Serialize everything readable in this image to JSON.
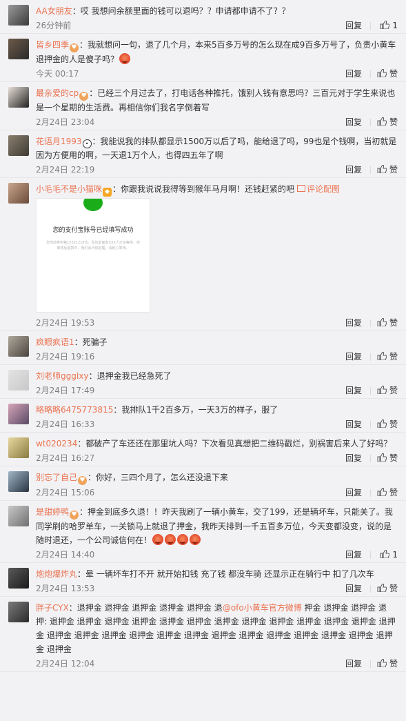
{
  "actions": {
    "reply_label": "回复",
    "like_label": "赞"
  },
  "comments": [
    {
      "user": "AA女朋友",
      "badge": "",
      "segments": [
        {
          "t": "text",
          "v": "：哎  我想问余额里面的钱可以退吗？？申请都申请不了？？"
        }
      ],
      "time": "26分钟前",
      "likes": "1",
      "avatar": {
        "c1": "#9a9a9a",
        "c2": "#3a3a3a"
      }
    },
    {
      "user": "皆乡四季",
      "badge": "heart",
      "segments": [
        {
          "t": "text",
          "v": "：我就想问一句，退了几个月，本来5百多万号的怎么现在成9百多万号了，负责小黄车退押金的人是傻子吗？"
        },
        {
          "t": "emoji",
          "v": "angry-face-emoji"
        }
      ],
      "time": "今天 00:17",
      "likes": "",
      "avatar": {
        "c1": "#6d5a4a",
        "c2": "#2b2b2b"
      }
    },
    {
      "user": "最亲爱的cp",
      "badge": "heart",
      "segments": [
        {
          "t": "text",
          "v": "：已经三个月过去了，打电话各种推托，饿别人钱有意思吗？三百元对于学生来说也是一个星期的生活费。再相信你们我名字倒着写"
        }
      ],
      "time": "2月24日 23:04",
      "likes": "",
      "avatar": {
        "c1": "#e8e0d8",
        "c2": "#222222"
      }
    },
    {
      "user": "花语月1993",
      "badge": "panda",
      "segments": [
        {
          "t": "text",
          "v": "：我能说我的排队都显示1500万以后了吗，能给退了吗，99也是个钱啊，当初就是因为方便用的啊，一天退1万个人，也得四五年了啊"
        }
      ],
      "time": "2月24日 22:19",
      "likes": "",
      "avatar": {
        "c1": "#8a7f6e",
        "c2": "#3d3a34"
      }
    },
    {
      "user": "小毛毛不是小猫咪",
      "badge": "cat",
      "segments": [
        {
          "t": "text",
          "v": "：你跟我说说我得等到猴年马月啊！还钱赶紧的吧"
        }
      ],
      "pic_link": "评论配图",
      "attachment": {
        "title": "您的支付宝账号已经填写成功",
        "body": "您当前排到第15321218位，队伍前面有XXX人正在等待，待审核后退款中，我们会尽快处理，请耐心等待。"
      },
      "time": "2月24日 19:53",
      "likes": "",
      "avatar": {
        "c1": "#c9a58a",
        "c2": "#6a4a3a"
      }
    },
    {
      "user": "疯眼疯语1",
      "badge": "",
      "segments": [
        {
          "t": "text",
          "v": "：死骗子"
        }
      ],
      "time": "2月24日 19:16",
      "likes": "",
      "avatar": {
        "c1": "#b0a89a",
        "c2": "#4a4540"
      }
    },
    {
      "user": "刘老师gggIxy",
      "badge": "",
      "segments": [
        {
          "t": "text",
          "v": "：退押金我已经急死了"
        }
      ],
      "time": "2月24日 17:49",
      "likes": "",
      "avatar": {
        "c1": "#e3e3e3",
        "c2": "#c8c8c8"
      }
    },
    {
      "user": "略略略6475773815",
      "badge": "",
      "segments": [
        {
          "t": "text",
          "v": "：我排队1千2百多万，一天3万的样子，服了"
        }
      ],
      "time": "2月24日 16:33",
      "likes": "",
      "avatar": {
        "c1": "#d6a5b8",
        "c2": "#5a4a66"
      }
    },
    {
      "user": "wt020234",
      "badge": "",
      "segments": [
        {
          "t": "text",
          "v": "：都破产了车还还在那里坑人吗？下次看见真想把二维码戳烂，别祸害后来人了好吗？"
        }
      ],
      "time": "2月24日 16:27",
      "likes": "",
      "avatar": {
        "c1": "#e8d9a0",
        "c2": "#8a7a40"
      }
    },
    {
      "user": "别忘了自己",
      "badge": "heart",
      "segments": [
        {
          "t": "text",
          "v": "：你好，三四个月了，怎么还没退下来"
        }
      ],
      "time": "2月24日 15:06",
      "likes": "",
      "avatar": {
        "c1": "#9fb6c8",
        "c2": "#2a3440"
      }
    },
    {
      "user": "是甜婷鸭",
      "badge": "heart",
      "segments": [
        {
          "t": "text",
          "v": "：押金到底多久退！！昨天我刷了一辆小黄车，交了199，还是辆坏车，只能关了。我同学刷的哈罗单车，一关锁马上就退了押金，我昨天排到一千五百多万位，今天变都没变，说的是随时退还，一个公司诚信何在！"
        },
        {
          "t": "emoji",
          "v": "angry-face-emoji"
        },
        {
          "t": "emoji",
          "v": "angry-face-emoji"
        },
        {
          "t": "emoji",
          "v": "angry-face-emoji"
        },
        {
          "t": "emoji",
          "v": "angry-face-emoji"
        }
      ],
      "time": "2月24日 14:40",
      "likes": "1",
      "avatar": {
        "c1": "#c8c8c8",
        "c2": "#707070"
      }
    },
    {
      "user": "炮炮爆炸丸",
      "badge": "",
      "segments": [
        {
          "t": "text",
          "v": "：晕 一辆坏车打不开 就开始扣钱 充了钱 都没车骑 还显示正在骑行中 扣了几次车"
        }
      ],
      "time": "2月24日 13:53",
      "likes": "",
      "avatar": {
        "c1": "#5a5a5a",
        "c2": "#1a1a1a"
      }
    },
    {
      "user": "胖子CYX",
      "badge": "",
      "segments": [
        {
          "t": "text",
          "v": "：退押金 退押金 退押金 退押金 退押金 退"
        },
        {
          "t": "link",
          "v": "@ofo小黄车官方微博"
        },
        {
          "t": "text",
          "v": " 押金 退押金 退押金 退押: 退押金 退押金 退押金 退押金 退押金 退押金 退押金 退押金 退押金 退押金 退押金 退押金 退押金 退押金 退押金 退押金 退押金 退押金 退押金 退押金 退押金 退押金 退押金 退押金 退押金 退押金 退押金"
        }
      ],
      "time": "2月24日 12:04",
      "likes": "",
      "avatar": {
        "c1": "#7a7a7a",
        "c2": "#2a2a2a"
      }
    }
  ]
}
